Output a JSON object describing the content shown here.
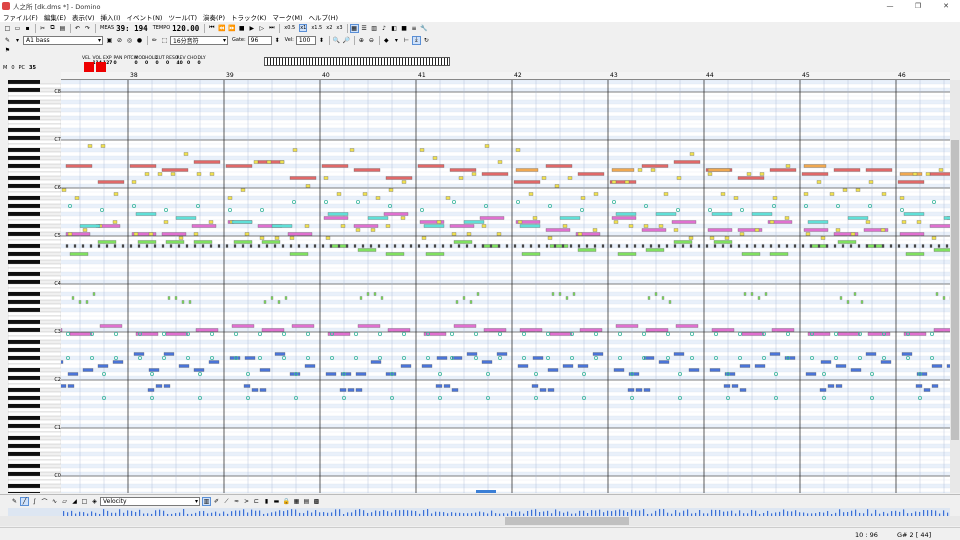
{
  "window": {
    "title": "人之所 [dk.dms *] - Domino"
  },
  "menu": [
    "ファイル(F)",
    "編集(E)",
    "表示(V)",
    "挿入(I)",
    "イベント(N)",
    "ツール(T)",
    "演奏(P)",
    "トラック(K)",
    "マーク(M)",
    "ヘルプ(H)"
  ],
  "toolbar": {
    "meas_label": "MEAS",
    "meas_value": "39: 194",
    "tempo_label": "TEMPO",
    "tempo_value": "120.00",
    "zoom_x": [
      "x0.5",
      "x1",
      "x1.5",
      "x2",
      "x3"
    ],
    "track_select": "A1 bass",
    "note_length": "16分音符",
    "gate_label": "Gate:",
    "gate_value": "96",
    "vel_label": "Vel:",
    "vel_value": "100"
  },
  "controls": {
    "names": [
      "VEL",
      "VOL",
      "EXP",
      "PAN",
      "PITCH",
      "MOD",
      "HOLD",
      "CUT",
      "RESO",
      "REV",
      "CHO",
      "DLY"
    ],
    "values": [
      "",
      "114",
      "127",
      "0",
      "",
      "0",
      "0",
      "0",
      "0",
      "40",
      "0",
      "0"
    ]
  },
  "position": {
    "m_label": "M",
    "m_value": "0",
    "pc_label": "PC",
    "pc_value": "35"
  },
  "measures": [
    "38",
    "39",
    "40",
    "41",
    "42",
    "43",
    "44",
    "45",
    "46"
  ],
  "octaves": [
    "C8",
    "C7",
    "C6",
    "C5",
    "C4",
    "C3",
    "C2",
    "C1",
    "C0"
  ],
  "bottom": {
    "controller_select": "Velocity"
  },
  "status": {
    "position": "10 : 96",
    "note": "G# 2 [ 44]"
  },
  "colors": {
    "bass": "#4a74d8",
    "pink": "#e070d0",
    "red": "#e06868",
    "orange": "#f0a850",
    "yellow": "#f0e050",
    "green": "#80e060",
    "cyan": "#60e0d8",
    "teal": "#40b8a0"
  }
}
